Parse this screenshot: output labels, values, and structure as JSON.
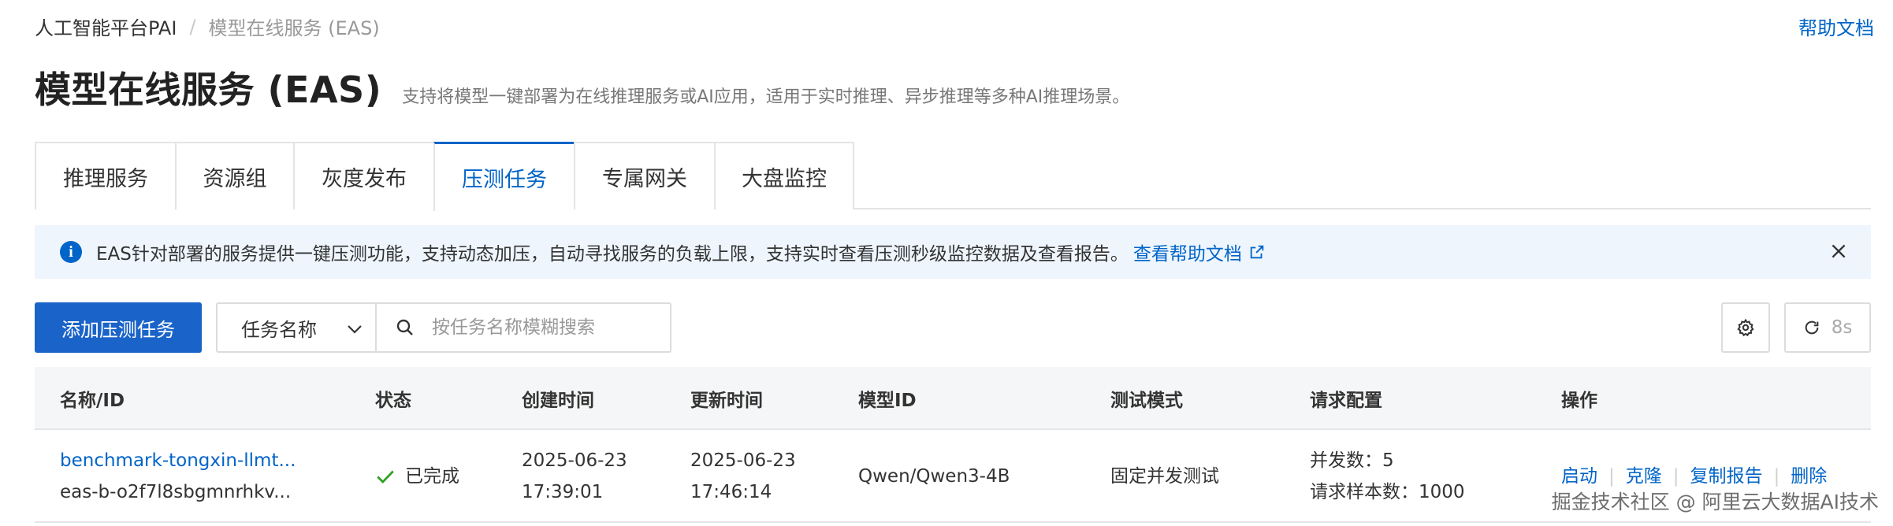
{
  "breadcrumb": {
    "root": "人工智能平台PAI",
    "separator": "/",
    "current": "模型在线服务 (EAS)"
  },
  "help_link": "帮助文档",
  "page": {
    "title": "模型在线服务 (EAS)",
    "subtitle": "支持将模型一键部署为在线推理服务或AI应用，适用于实时推理、异步推理等多种AI推理场景。"
  },
  "tabs": [
    {
      "label": "推理服务"
    },
    {
      "label": "资源组"
    },
    {
      "label": "灰度发布"
    },
    {
      "label": "压测任务",
      "active": true
    },
    {
      "label": "专属网关"
    },
    {
      "label": "大盘监控"
    }
  ],
  "notice": {
    "text": "EAS针对部署的服务提供一键压测功能，支持动态加压，自动寻找服务的负载上限，支持实时查看压测秒级监控数据及查看报告。",
    "link": "查看帮助文档"
  },
  "toolbar": {
    "add_button": "添加压测任务",
    "filter_select": "任务名称",
    "search_placeholder": "按任务名称模糊搜索",
    "refresh_label": "8s"
  },
  "table": {
    "headers": {
      "name": "名称/ID",
      "status": "状态",
      "created": "创建时间",
      "updated": "更新时间",
      "model": "模型ID",
      "mode": "测试模式",
      "config": "请求配置",
      "ops": "操作"
    },
    "rows": [
      {
        "name": "benchmark-tongxin-llmt...",
        "id": "eas-b-o2f7l8sbgmnrhkv...",
        "status": "已完成",
        "created_date": "2025-06-23",
        "created_time": "17:39:01",
        "updated_date": "2025-06-23",
        "updated_time": "17:46:14",
        "model": "Qwen/Qwen3-4B",
        "mode": "固定并发测试",
        "concurrency": "并发数：5",
        "samples": "请求样本数：1000",
        "ops": [
          "启动",
          "克隆",
          "复制报告",
          "删除"
        ]
      }
    ]
  },
  "watermark": "掘金技术社区 @ 阿里云大数据AI技术",
  "colors": {
    "accent": "#0064c8",
    "primary_button": "#1a63c8",
    "notice_bg": "#eef5fd",
    "success": "#2ea121"
  }
}
